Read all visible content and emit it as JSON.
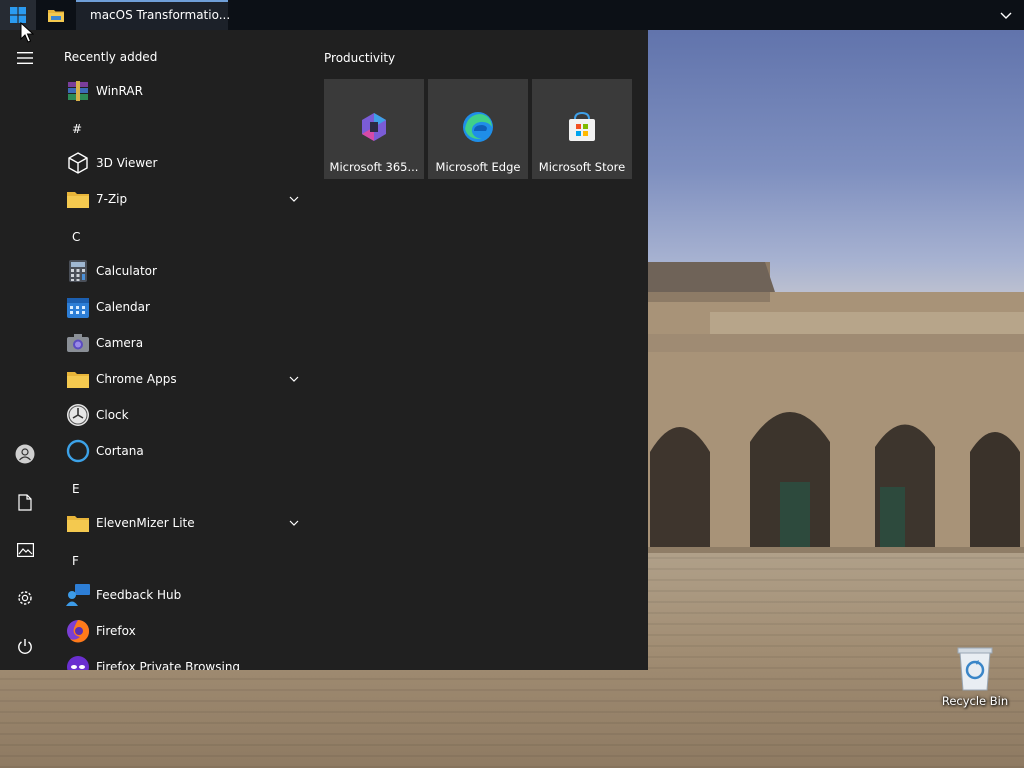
{
  "taskbar": {
    "start_icon": "windows-logo-icon",
    "explorer_icon": "folder-icon",
    "chrome_window": {
      "icon": "chrome-icon",
      "title": "macOS Transformatio..."
    },
    "overflow_icon": "chevron-down-icon"
  },
  "start_menu": {
    "rail": [
      {
        "icon": "hamburger-menu-icon"
      },
      {
        "icon": "user-account-icon"
      },
      {
        "icon": "documents-icon"
      },
      {
        "icon": "pictures-icon"
      },
      {
        "icon": "settings-gear-icon"
      },
      {
        "icon": "power-icon"
      }
    ],
    "app_list": {
      "recently_added_heading": "Recently added",
      "recent_app": {
        "label": "WinRAR",
        "icon": "winrar-icon"
      },
      "letters": {
        "hash": "#",
        "c": "C",
        "e": "E",
        "f": "F"
      },
      "apps": {
        "viewer3d": {
          "label": "3D Viewer",
          "icon": "cube-icon"
        },
        "sevenzip": {
          "label": "7-Zip",
          "icon": "folder-icon",
          "expandable": true
        },
        "calculator": {
          "label": "Calculator",
          "icon": "calculator-icon"
        },
        "calendar": {
          "label": "Calendar",
          "icon": "calendar-icon"
        },
        "camera": {
          "label": "Camera",
          "icon": "camera-icon"
        },
        "chrome_apps": {
          "label": "Chrome Apps",
          "icon": "folder-icon",
          "expandable": true
        },
        "clock": {
          "label": "Clock",
          "icon": "clock-icon"
        },
        "cortana": {
          "label": "Cortana",
          "icon": "cortana-ring-icon"
        },
        "elevenmizer": {
          "label": "ElevenMizer Lite",
          "icon": "folder-icon",
          "expandable": true
        },
        "feedback": {
          "label": "Feedback Hub",
          "icon": "feedback-hub-icon"
        },
        "firefox": {
          "label": "Firefox",
          "icon": "firefox-icon"
        },
        "firefox_private": {
          "label": "Firefox Private Browsing",
          "icon": "firefox-private-icon"
        }
      }
    },
    "tiles": {
      "group_title": "Productivity",
      "items": [
        {
          "label": "Microsoft 365...",
          "icon": "microsoft-365-icon"
        },
        {
          "label": "Microsoft Edge",
          "icon": "edge-icon"
        },
        {
          "label": "Microsoft Store",
          "icon": "store-icon"
        }
      ]
    }
  },
  "desktop": {
    "recycle_bin": {
      "label": "Recycle Bin",
      "icon": "recycle-bin-icon"
    }
  },
  "colors": {
    "taskbar": "#0c1016",
    "start_menu": "#202020",
    "tile": "#3a3a3a",
    "accent": "#6f9fd8"
  }
}
